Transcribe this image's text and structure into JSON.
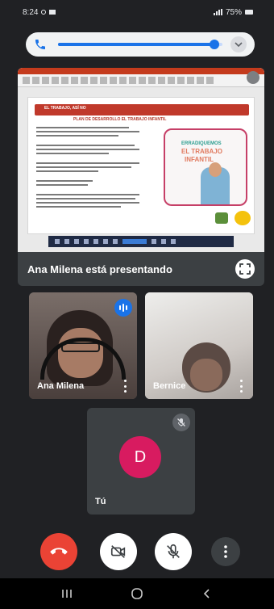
{
  "status_bar": {
    "time": "8:24",
    "battery": "75%"
  },
  "volume": {
    "level_percent": 95
  },
  "presentation": {
    "presenter_label": "Ana Milena está presentando",
    "doc_header": "EL TRABAJO, ASÍ NO",
    "doc_subheader": "PLAN DE DESARROLLO EL TRABAJO INFANTIL",
    "poster_line1": "ERRADIQUEMOS",
    "poster_line2": "EL TRABAJO",
    "poster_line3": "INFANTIL"
  },
  "participants": [
    {
      "name": "Ana Milena",
      "speaking": true
    },
    {
      "name": "Bernice",
      "speaking": false
    },
    {
      "name": "Tú",
      "avatar_letter": "D",
      "avatar_color": "#d81b60"
    }
  ],
  "colors": {
    "end_call": "#ea4335",
    "accent": "#1a73e8",
    "background": "#202124"
  }
}
